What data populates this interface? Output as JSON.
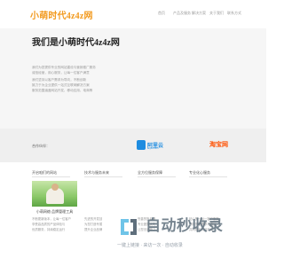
{
  "header": {
    "logo": "小萌时代4z4z网",
    "nav": [
      "首页",
      "产品及服务",
      "解决方案",
      "关于我们",
      "联系方式"
    ]
  },
  "hero": {
    "title": "我们是小萌时代4z4z网",
    "paragraphs": [
      "我们为您提供专业的网站建设与营销推广服务",
      "诚信经营，用心服务，让每一位客户满意",
      "我们坚持以客户需求为导向，不断创新",
      "致力于为企业提供一站式互联网解决方案",
      "服务范围涵盖网站开发、移动应用、电商等"
    ]
  },
  "partners": {
    "label": "合作伙伴：",
    "items": [
      {
        "name": "阿里云",
        "sub": "aliyun.com"
      },
      {
        "name": "淘宝网"
      }
    ]
  },
  "sections": {
    "columns": [
      {
        "title": "开启咱们的网站"
      },
      {
        "title": "技术与服务未来"
      },
      {
        "title": "全方位服务保障"
      },
      {
        "title": "专业化心服务"
      }
    ],
    "caption": "小萌网络·品牌管理工具",
    "texts": [
      [
        "不断更新版本，让每一位客户",
        "享受高品质的产品体验与",
        "优质服务，持续稳定运行"
      ],
      [
        "先进的开发技术与团队",
        "为您打造专属的解决方案",
        "提升企业品牌形象与价值"
      ],
      [
        "完善的售后服务体系",
        "专业团队实时响应支持",
        "让您无后顾之忧"
      ],
      [
        "贴心的一对一客户服务",
        "倾听您的需求与建议",
        "共同成长共创未来"
      ]
    ]
  },
  "watermark": {
    "title": "自动秒收录",
    "sub": "一键上链接 · 来访一次 · 自动收录"
  },
  "colors": {
    "accent": "#f29a1f",
    "aliyun": "#1d8ce0",
    "taobao": "#ff5000"
  }
}
